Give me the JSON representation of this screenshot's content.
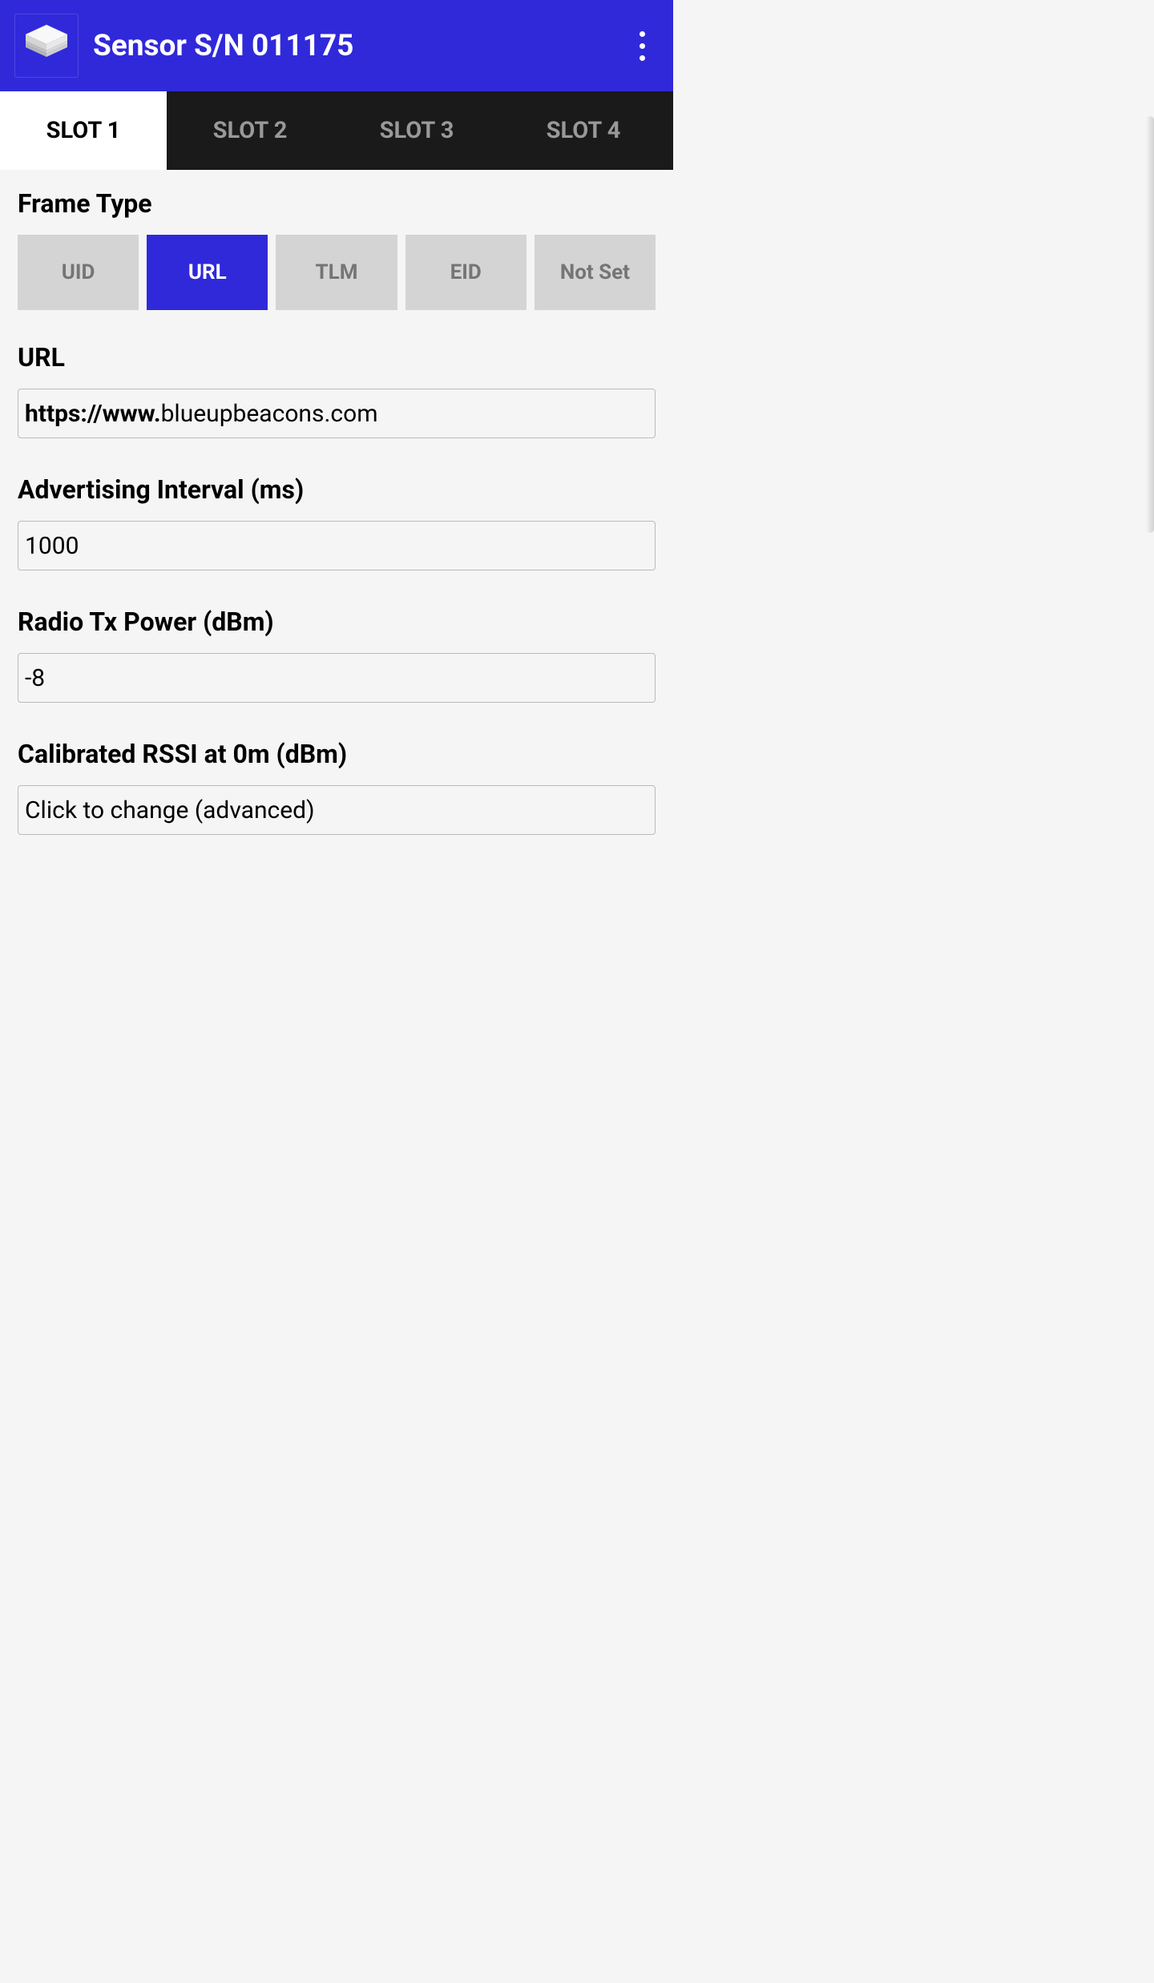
{
  "header": {
    "title": "Sensor S/N 011175",
    "icon_name": "sensor-icon"
  },
  "tabs": {
    "items": [
      {
        "label": "SLOT 1",
        "active": true
      },
      {
        "label": "SLOT 2",
        "active": false
      },
      {
        "label": "SLOT 3",
        "active": false
      },
      {
        "label": "SLOT 4",
        "active": false
      }
    ]
  },
  "frame_type": {
    "label": "Frame Type",
    "options": [
      {
        "label": "UID",
        "active": false
      },
      {
        "label": "URL",
        "active": true
      },
      {
        "label": "TLM",
        "active": false
      },
      {
        "label": "EID",
        "active": false
      },
      {
        "label": "Not Set",
        "active": false
      }
    ]
  },
  "url": {
    "label": "URL",
    "prefix": "https://www.",
    "value": "blueupbeacons.com"
  },
  "adv_interval": {
    "label": "Advertising Interval (ms)",
    "value": "1000"
  },
  "tx_power": {
    "label": "Radio Tx Power (dBm)",
    "value": "-8"
  },
  "rssi": {
    "label": "Calibrated RSSI at 0m (dBm)",
    "placeholder": "Click to change (advanced)"
  }
}
